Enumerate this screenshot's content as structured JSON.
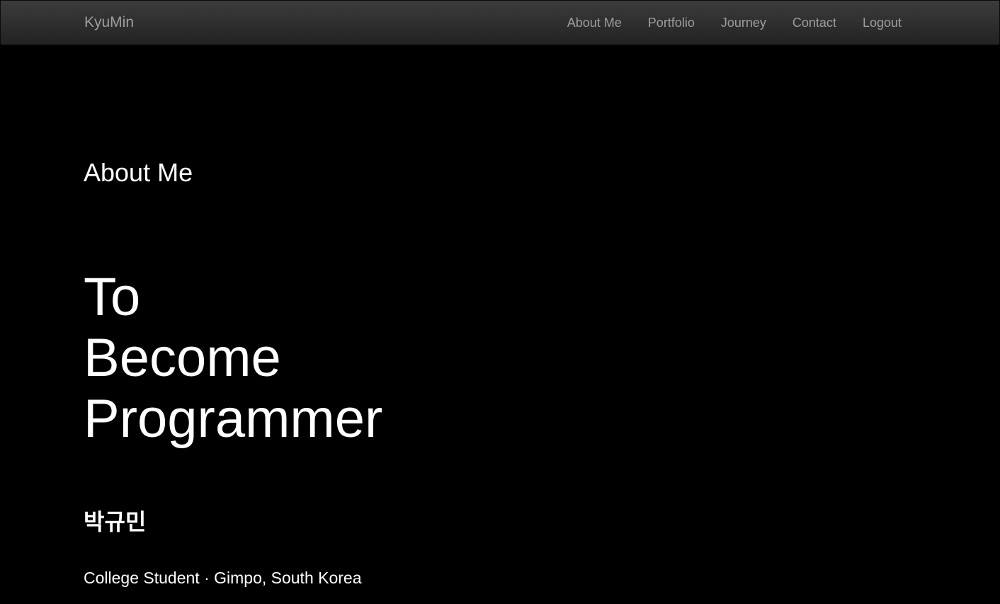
{
  "navbar": {
    "brand": "KyuMin",
    "items": [
      {
        "label": "About Me"
      },
      {
        "label": "Portfolio"
      },
      {
        "label": "Journey"
      },
      {
        "label": "Contact"
      },
      {
        "label": "Logout"
      }
    ]
  },
  "main": {
    "section_title": "About Me",
    "headline": [
      "To",
      "Become",
      "Programmer"
    ],
    "name": "박규민",
    "subtitle": "College Student · Gimpo, South Korea"
  },
  "colors": {
    "background": "#000000",
    "navbar_top": "#3c3c3c",
    "navbar_bottom": "#222222",
    "nav_text": "#9d9d9d",
    "content_text": "#ffffff"
  }
}
